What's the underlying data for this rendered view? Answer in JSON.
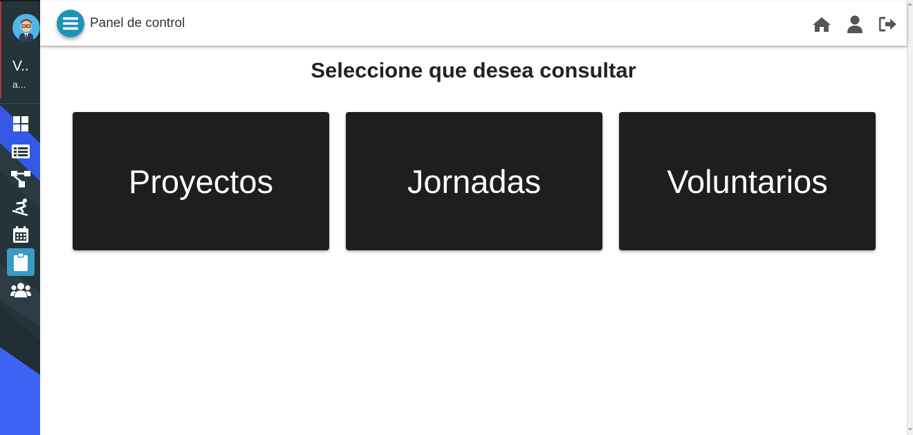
{
  "sidebar": {
    "user_name": "V..",
    "user_sub": "a...",
    "items": [
      {
        "icon": "dashboard-grid-icon",
        "active": false
      },
      {
        "icon": "list-table-icon",
        "active": false
      },
      {
        "icon": "sitemap-icon",
        "active": false
      },
      {
        "icon": "snowboarding-icon",
        "active": false
      },
      {
        "icon": "calendar-icon",
        "active": false
      },
      {
        "icon": "clipboard-icon",
        "active": true
      },
      {
        "icon": "users-icon",
        "active": false
      }
    ]
  },
  "topbar": {
    "title": "Panel de control",
    "icons": [
      "home-icon",
      "user-icon",
      "sign-out-icon"
    ]
  },
  "main": {
    "heading": "Seleccione que desea consultar",
    "cards": [
      "Proyectos",
      "Jornadas",
      "Voluntarios"
    ]
  },
  "colors": {
    "sidebar_bg": "#25343b",
    "accent": "#1e93b8",
    "active_item": "#3a9bc4",
    "sidebar_blue": "#3d63f5",
    "card_bg": "#1e1e1e"
  }
}
